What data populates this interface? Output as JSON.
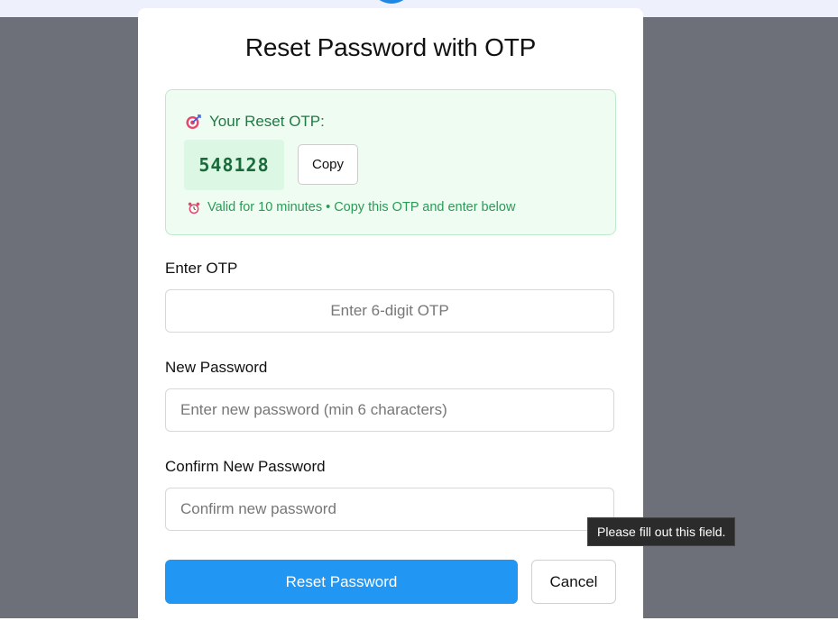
{
  "modal": {
    "title": "Reset Password with OTP"
  },
  "otp_panel": {
    "heading": "Your Reset OTP:",
    "heading_icon": "target-icon",
    "code": "548128",
    "copy_label": "Copy",
    "note": "Valid for 10 minutes • Copy this OTP and enter below",
    "note_icon": "alarm-clock-icon"
  },
  "form": {
    "otp": {
      "label": "Enter OTP",
      "placeholder": "Enter 6-digit OTP",
      "value": ""
    },
    "new_password": {
      "label": "New Password",
      "placeholder": "Enter new password (min 6 characters)",
      "value": ""
    },
    "confirm_password": {
      "label": "Confirm New Password",
      "placeholder": "Confirm new password",
      "value": ""
    },
    "submit_label": "Reset Password",
    "cancel_label": "Cancel"
  },
  "validation": {
    "tooltip": "Please fill out this field."
  },
  "colors": {
    "accent": "#2196f3",
    "success_text": "#2a9b57",
    "success_bg": "#effcf2",
    "overlay": "#6e7079"
  }
}
